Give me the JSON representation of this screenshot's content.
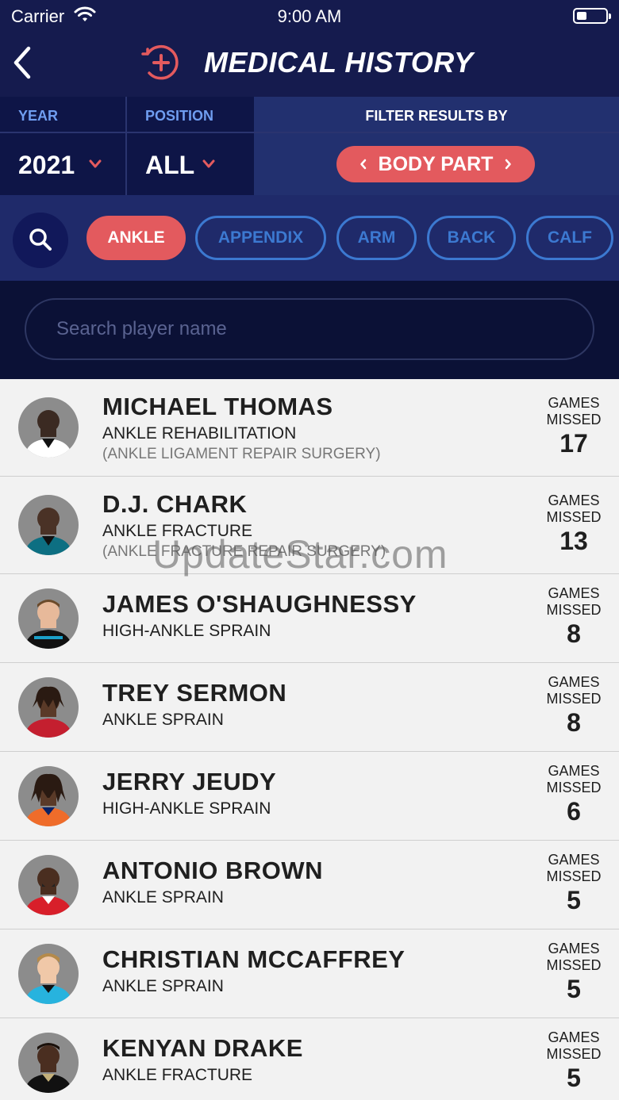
{
  "status_bar": {
    "carrier": "Carrier",
    "time": "9:00 AM"
  },
  "header": {
    "title": "MEDICAL HISTORY"
  },
  "filters": {
    "year_label": "YEAR",
    "year_value": "2021",
    "position_label": "POSITION",
    "position_value": "ALL",
    "filter_by_label": "FILTER RESULTS BY",
    "filter_by_value": "BODY PART"
  },
  "chips": [
    "ANKLE",
    "APPENDIX",
    "ARM",
    "BACK",
    "CALF"
  ],
  "search": {
    "placeholder": "Search player name"
  },
  "players": [
    {
      "name": "MICHAEL THOMAS",
      "injury": "ANKLE REHABILITATION",
      "detail": "(ANKLE LIGAMENT REPAIR SURGERY)",
      "games_label": "GAMES\nMISSED",
      "games": "17"
    },
    {
      "name": "D.J. CHARK",
      "injury": "ANKLE FRACTURE",
      "detail": "(ANKLE FRACTURE REPAIR SURGERY)",
      "games_label": "GAMES\nMISSED",
      "games": "13"
    },
    {
      "name": "JAMES O'SHAUGHNESSY",
      "injury": "HIGH-ANKLE SPRAIN",
      "games_label": "GAMES\nMISSED",
      "games": "8"
    },
    {
      "name": "TREY SERMON",
      "injury": "ANKLE SPRAIN",
      "games_label": "GAMES\nMISSED",
      "games": "8"
    },
    {
      "name": "JERRY JEUDY",
      "injury": "HIGH-ANKLE SPRAIN",
      "games_label": "GAMES\nMISSED",
      "games": "6"
    },
    {
      "name": "ANTONIO BROWN",
      "injury": "ANKLE SPRAIN",
      "games_label": "GAMES\nMISSED",
      "games": "5"
    },
    {
      "name": "CHRISTIAN MCCAFFREY",
      "injury": "ANKLE SPRAIN",
      "games_label": "GAMES\nMISSED",
      "games": "5"
    },
    {
      "name": "KENYAN DRAKE",
      "injury": "ANKLE FRACTURE",
      "games_label": "GAMES\nMISSED",
      "games": "5"
    }
  ],
  "watermark": "UpdateStar.com",
  "colors": {
    "navy": "#151b4e",
    "accent_red": "#e35a5e",
    "chip_blue": "#3c79d1",
    "label_blue": "#6f9df0",
    "list_bg": "#f2f2f2"
  }
}
